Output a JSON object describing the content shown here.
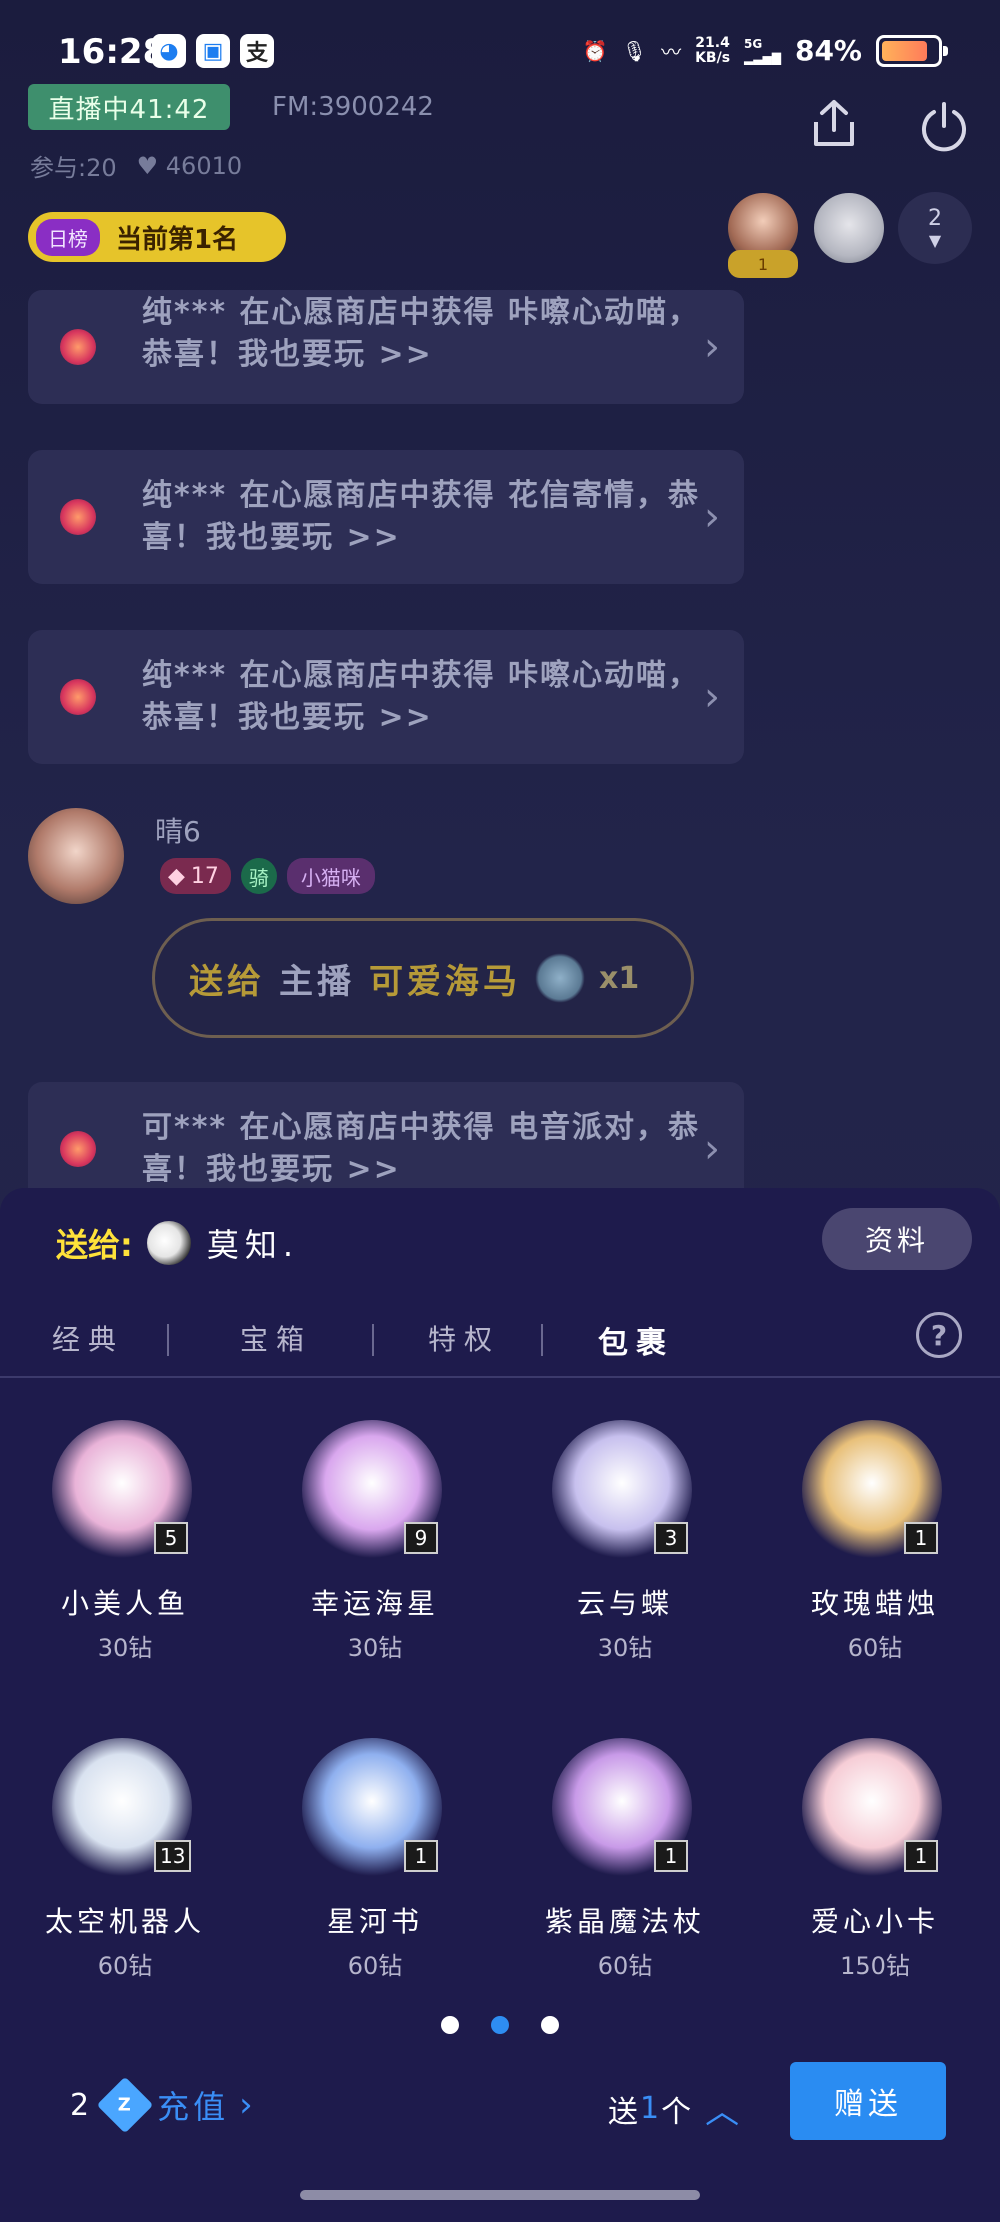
{
  "status_bar": {
    "time": "16:28",
    "net_speed": "21.4",
    "net_unit": "KB/s",
    "signal": "5G",
    "battery_pct": "84%",
    "battery_level": 0.84,
    "app_icons": [
      "baidu-icon",
      "message-icon",
      "alipay-icon"
    ]
  },
  "header": {
    "live_badge": "直播中41:42",
    "fm": "FM:3900242",
    "participants": "参与:20",
    "likes": "46010",
    "rank_tag": "日榜",
    "rank_text": "当前第1名",
    "top_viewer_rank": "1",
    "viewer_count": "2"
  },
  "chat": {
    "messages": [
      {
        "text": "纯*** 在心愿商店中获得 咔嚓心动喵，恭喜！我也要玩 >>"
      },
      {
        "text": "纯*** 在心愿商店中获得 花信寄情，恭喜！我也要玩 >>"
      },
      {
        "text": "纯*** 在心愿商店中获得 咔嚓心动喵，恭喜！我也要玩 >>"
      },
      {
        "text": "可*** 在心愿商店中获得 电音派对，恭喜！我也要玩 >>"
      }
    ],
    "user": {
      "name": "晴6",
      "level": "17",
      "ride": "骑",
      "tag": "小猫咪"
    },
    "gift_msg": {
      "send_to": "送给",
      "role": "主播",
      "gift": "可爱海马",
      "count": "x1"
    }
  },
  "sheet": {
    "send_to_label": "送给:",
    "recipient": "莫知.",
    "profile_button": "资料",
    "tabs": [
      "经典",
      "宝箱",
      "特权",
      "包裹"
    ],
    "active_tab": "包裹",
    "gifts": [
      {
        "name": "小美人鱼",
        "price": "30钻",
        "count": "5",
        "color": "#e9b3d8"
      },
      {
        "name": "幸运海星",
        "price": "30钻",
        "count": "9",
        "color": "#d9a7ee"
      },
      {
        "name": "云与蝶",
        "price": "30钻",
        "count": "3",
        "color": "#c7c0ee"
      },
      {
        "name": "玫瑰蜡烛",
        "price": "60钻",
        "count": "1",
        "color": "#e8c07a"
      },
      {
        "name": "太空机器人",
        "price": "60钻",
        "count": "13",
        "color": "#d9e2f0"
      },
      {
        "name": "星河书",
        "price": "60钻",
        "count": "1",
        "color": "#8fb0ef"
      },
      {
        "name": "紫晶魔法杖",
        "price": "60钻",
        "count": "1",
        "color": "#c89ae8"
      },
      {
        "name": "爱心小卡",
        "price": "150钻",
        "count": "1",
        "color": "#f6cdd6"
      }
    ],
    "page_dots": 3,
    "active_page": 2,
    "balance": "2",
    "diamond_letter": "Z",
    "recharge_label": "充值",
    "qty_prefix": "送",
    "qty_value": "1",
    "qty_suffix": "个",
    "send_button": "赠送"
  }
}
